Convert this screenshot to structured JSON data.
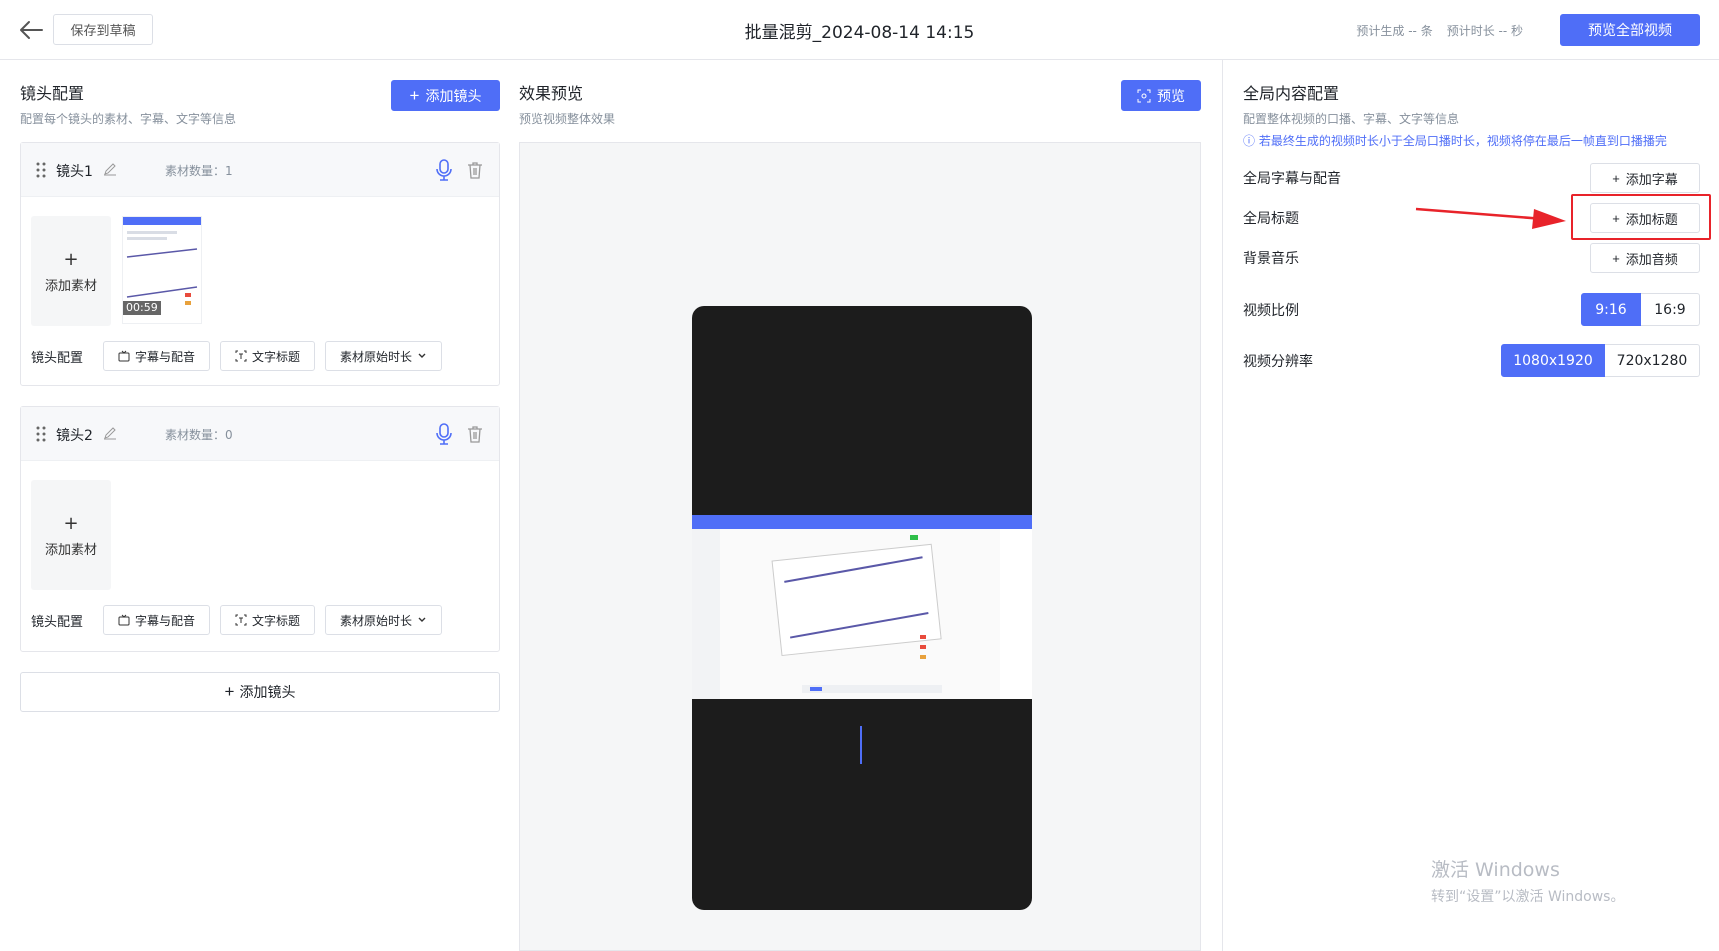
{
  "header": {
    "save_draft": "保存到草稿",
    "title": "批量混剪_2024-08-14 14:15",
    "expected_count": "预计生成 -- 条",
    "expected_duration": "预计时长 -- 秒",
    "preview_all": "预览全部视频"
  },
  "shots": {
    "title": "镜头配置",
    "subtitle": "配置每个镜头的素材、字幕、文字等信息",
    "add_shot": "添加镜头",
    "items": [
      {
        "name": "镜头1",
        "count": "素材数量：1",
        "add_material": "添加素材",
        "thumb_duration": "00:59",
        "config_label": "镜头配置",
        "subtitle_btn": "字幕与配音",
        "text_title_btn": "文字标题",
        "duration_btn": "素材原始时长"
      },
      {
        "name": "镜头2",
        "count": "素材数量：0",
        "add_material": "添加素材",
        "config_label": "镜头配置",
        "subtitle_btn": "字幕与配音",
        "text_title_btn": "文字标题",
        "duration_btn": "素材原始时长"
      }
    ],
    "add_shot_bottom": "添加镜头"
  },
  "preview": {
    "title": "效果预览",
    "subtitle": "预览视频整体效果",
    "button": "预览"
  },
  "global": {
    "title": "全局内容配置",
    "subtitle": "配置整体视频的口播、字幕、文字等信息",
    "notice": "若最终生成的视频时长小于全局口播时长，视频将停在最后一帧直到口播播完",
    "subtitle_label": "全局字幕与配音",
    "add_subtitle": "添加字幕",
    "title_label": "全局标题",
    "add_title": "添加标题",
    "music_label": "背景音乐",
    "add_audio": "添加音频",
    "ratio_label": "视频比例",
    "ratio_options": [
      "9:16",
      "16:9"
    ],
    "ratio_selected": "9:16",
    "resolution_label": "视频分辨率",
    "resolution_options": [
      "1080x1920",
      "720x1280"
    ],
    "resolution_selected": "1080x1920"
  },
  "watermark": {
    "line1": "激活 Windows",
    "line2": "转到“设置”以激活 Windows。"
  },
  "colors": {
    "accent": "#4f6ef7",
    "highlight": "#e8232a"
  }
}
